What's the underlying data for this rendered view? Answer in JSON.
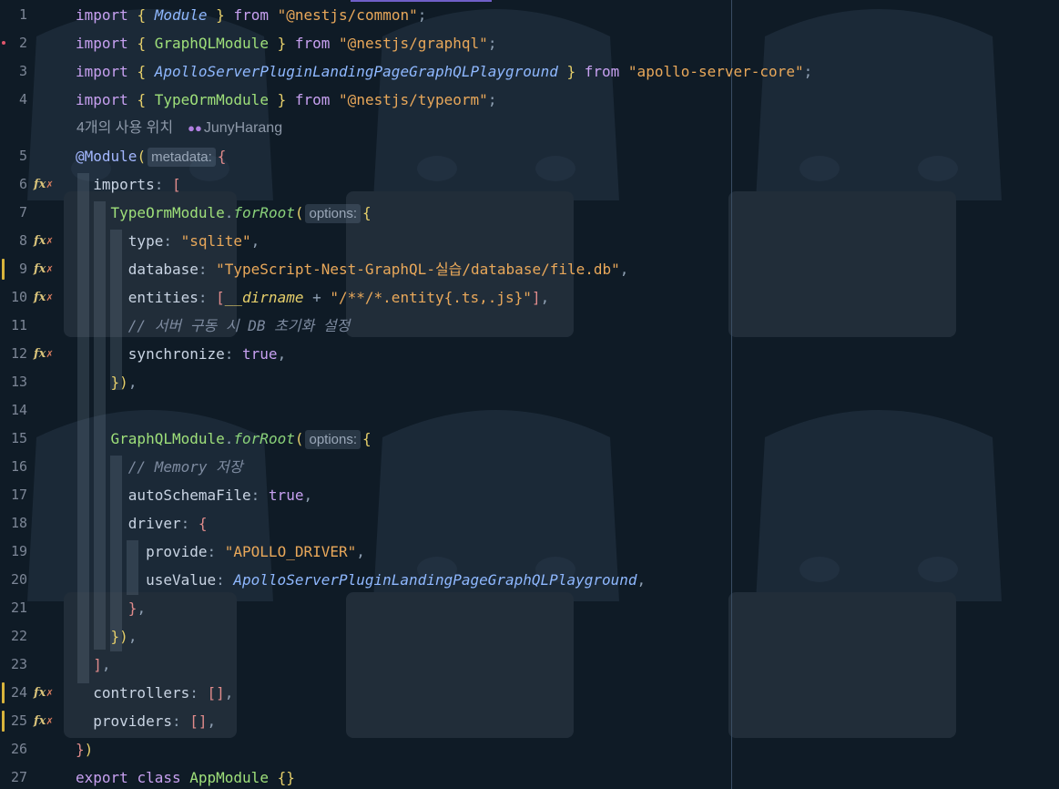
{
  "editor": {
    "codelens": {
      "usages": "4개의 사용 위치",
      "author": "JunyHarang"
    },
    "hints": {
      "metadata": "metadata:",
      "options": "options:"
    },
    "gutter_icon": "fx"
  },
  "lines": [
    {
      "n": "1"
    },
    {
      "n": "2"
    },
    {
      "n": "3"
    },
    {
      "n": "4"
    },
    {
      "n": "5"
    },
    {
      "n": "6"
    },
    {
      "n": "7"
    },
    {
      "n": "8"
    },
    {
      "n": "9"
    },
    {
      "n": "10"
    },
    {
      "n": "11"
    },
    {
      "n": "12"
    },
    {
      "n": "13"
    },
    {
      "n": "14"
    },
    {
      "n": "15"
    },
    {
      "n": "16"
    },
    {
      "n": "17"
    },
    {
      "n": "18"
    },
    {
      "n": "19"
    },
    {
      "n": "20"
    },
    {
      "n": "21"
    },
    {
      "n": "22"
    },
    {
      "n": "23"
    },
    {
      "n": "24"
    },
    {
      "n": "25"
    },
    {
      "n": "26"
    },
    {
      "n": "27"
    }
  ],
  "tokens": {
    "import": "import",
    "from": "from",
    "Module": "Module",
    "GraphQLModule": "GraphQLModule",
    "Playground": "ApolloServerPluginLandingPageGraphQLPlayground",
    "TypeOrmModule": "TypeOrmModule",
    "s_common": "\"@nestjs/common\"",
    "s_graphql": "\"@nestjs/graphql\"",
    "s_apollo": "\"apollo-server-core\"",
    "s_typeorm": "\"@nestjs/typeorm\"",
    "atModule": "@Module",
    "imports": "imports",
    "forRoot": "forRoot",
    "type": "type",
    "s_sqlite": "\"sqlite\"",
    "database": "database",
    "s_db": "\"TypeScript-Nest-GraphQL-실습/database/file.db\"",
    "entities": "entities",
    "dirname": "__dirname",
    "s_entity": "\"/**/*.entity{.ts,.js}\"",
    "c_db": "// 서버 구동 시 DB 초기화 설정",
    "synchronize": "synchronize",
    "true": "true",
    "c_mem": "// Memory 저장",
    "autoSchemaFile": "autoSchemaFile",
    "driver": "driver",
    "provide": "provide",
    "s_driver": "\"APOLLO_DRIVER\"",
    "useValue": "useValue",
    "controllers": "controllers",
    "providers": "providers",
    "export": "export",
    "class": "class",
    "AppModule": "AppModule"
  }
}
